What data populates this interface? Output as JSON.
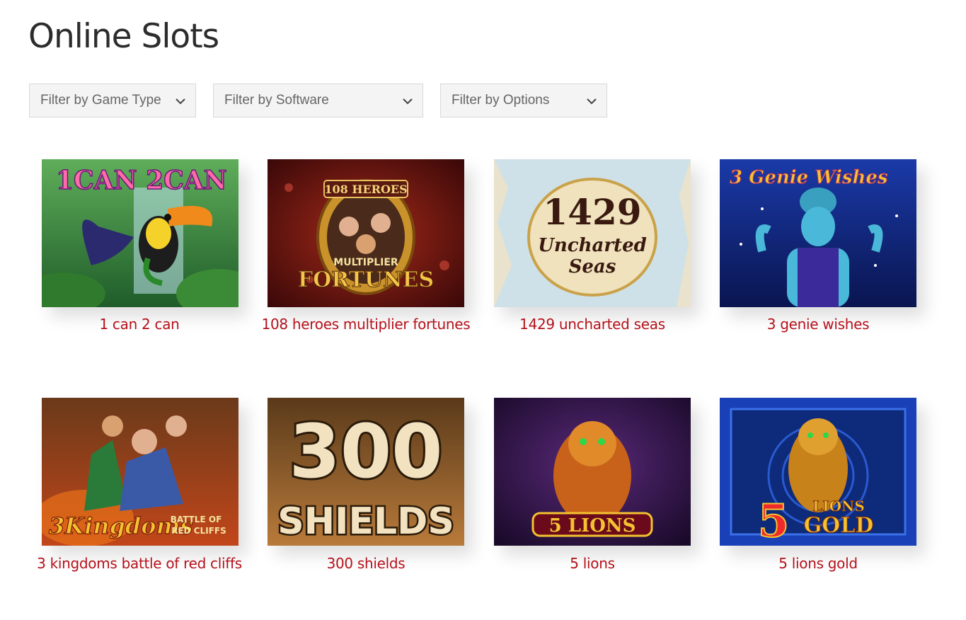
{
  "page": {
    "title": "Online Slots"
  },
  "filters": [
    {
      "label": "Filter by Game Type"
    },
    {
      "label": "Filter by Software"
    },
    {
      "label": "Filter by Options"
    }
  ],
  "games": [
    {
      "title": "1 can 2 can",
      "logo_text": "1CAN 2CAN"
    },
    {
      "title": "108 heroes multiplier fortunes",
      "logo_text": "108 HEROES",
      "logo_sub": "MULTIPLIER",
      "logo_sub2": "FORTUNES"
    },
    {
      "title": "1429 uncharted seas",
      "logo_text": "1429",
      "logo_sub": "Uncharted",
      "logo_sub2": "Seas"
    },
    {
      "title": "3 genie wishes",
      "logo_text": "3 Genie Wishes"
    },
    {
      "title": "3 kingdoms battle of red cliffs",
      "logo_text": "3Kingdoms",
      "logo_sub": "BATTLE OF",
      "logo_sub2": "RED CLIFFS"
    },
    {
      "title": "300 shields",
      "logo_text": "300",
      "logo_sub": "SHIELDS"
    },
    {
      "title": "5 lions",
      "logo_text": "5 LIONS"
    },
    {
      "title": "5 lions gold",
      "logo_text": "5",
      "logo_sub": "LIONS",
      "logo_sub2": "GOLD"
    }
  ],
  "colors": {
    "title_red": "#b5111b",
    "heading": "#2c2c2c",
    "filter_bg": "#f4f4f4"
  }
}
